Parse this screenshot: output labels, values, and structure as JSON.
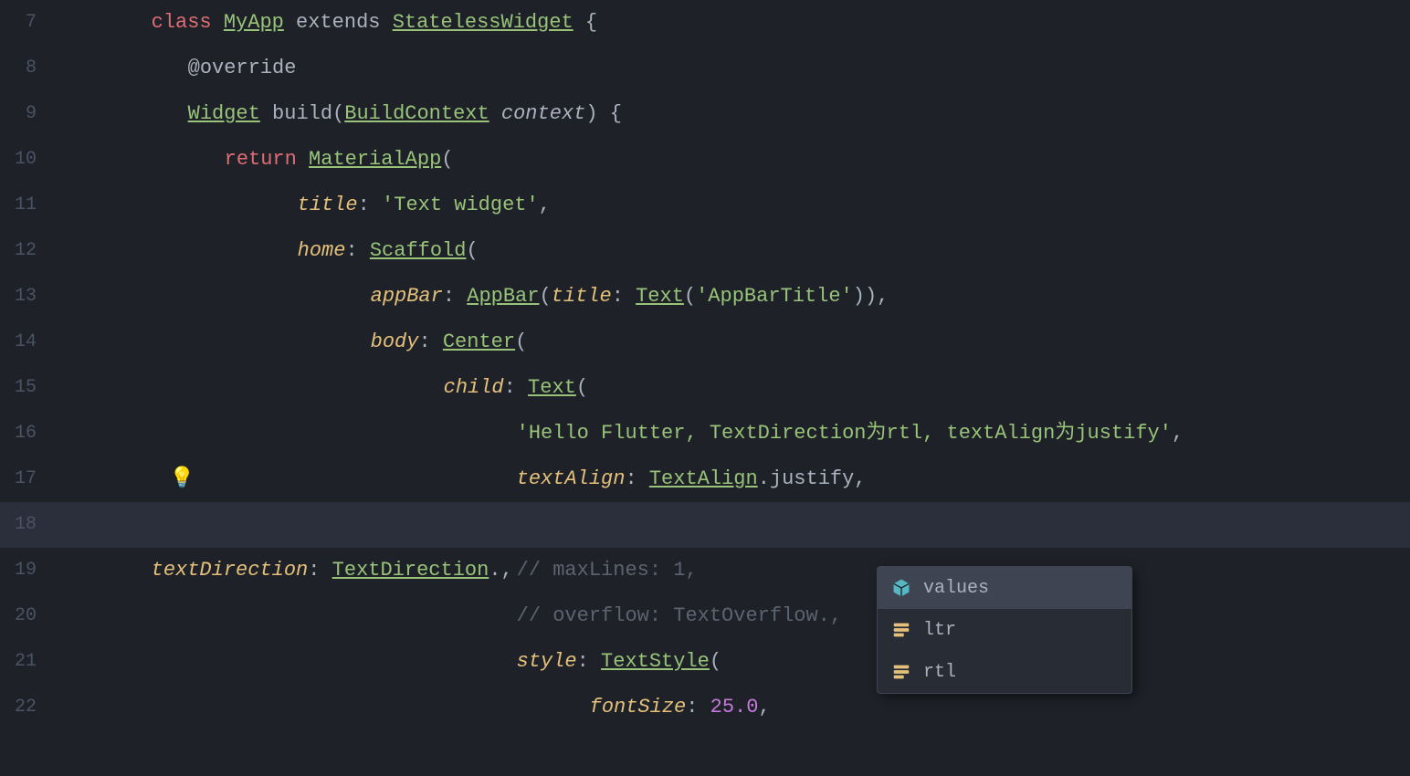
{
  "editor": {
    "background": "#1e2228",
    "lines": [
      {
        "num": "7",
        "content": "class MyApp extends StatelessWidget {"
      },
      {
        "num": "8",
        "content": "  @override"
      },
      {
        "num": "9",
        "content": "  Widget build(BuildContext context) {"
      },
      {
        "num": "10",
        "content": "    return MaterialApp("
      },
      {
        "num": "11",
        "content": "      title: 'Text widget',"
      },
      {
        "num": "12",
        "content": "      home: Scaffold("
      },
      {
        "num": "13",
        "content": "        appBar: AppBar(title: Text('AppBarTitle')),"
      },
      {
        "num": "14",
        "content": "        body: Center("
      },
      {
        "num": "15",
        "content": "          child: Text("
      },
      {
        "num": "16",
        "content": "            'Hello Flutter, TextDirection为rtl, textAlign为justify',"
      },
      {
        "num": "17",
        "content": "            textAlign: TextAlign.justify,"
      },
      {
        "num": "18",
        "content": "            textDirection: TextDirection.,"
      },
      {
        "num": "19",
        "content": "            // maxLines: 1,"
      },
      {
        "num": "20",
        "content": "            // overflow: TextOverflow.,"
      },
      {
        "num": "21",
        "content": "            style: TextStyle("
      },
      {
        "num": "22",
        "content": "              fontSize: 25.0,"
      }
    ],
    "autocomplete": {
      "items": [
        {
          "id": "values",
          "icon": "cube",
          "label": "values",
          "selected": true
        },
        {
          "id": "ltr",
          "icon": "enum",
          "label": "ltr",
          "selected": false
        },
        {
          "id": "rtl",
          "icon": "enum",
          "label": "rtl",
          "selected": false
        }
      ]
    }
  }
}
